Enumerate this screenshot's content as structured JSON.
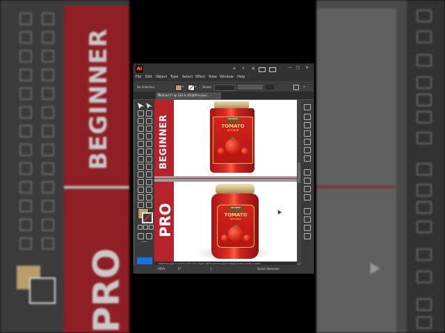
{
  "app": {
    "logo": "Ai",
    "menu": [
      "File",
      "Edit",
      "Object",
      "Type",
      "Select",
      "Effect",
      "View",
      "Window",
      "Help"
    ],
    "window_controls": [
      "—",
      "▢",
      "✕"
    ]
  },
  "control_bar": {
    "selection": "No Selection",
    "stroke_label": "Stroke:",
    "stroke_value": "0"
  },
  "document_tab": {
    "title": "Untitled-1* @ 100 % (RGB/Preview)",
    "close": "×"
  },
  "artboards": [
    {
      "label": "BEGINNER",
      "jar": {
        "brand": "NEW BRAND",
        "title": "TOMATO",
        "subtitle": "KETCHUP"
      }
    },
    {
      "label": "PRO",
      "jar": {
        "brand": "NEW BRAND",
        "title": "TOMATO",
        "subtitle": "KETCHUP"
      }
    }
  ],
  "status": {
    "hint": "Select the path or anchor point of an object  |  Shift+Click to select multiple anchor points or paths",
    "zoom": "100%",
    "rotation": "0°",
    "artboard_num": "1",
    "tool": "Direct Selection"
  },
  "background_copy": {
    "label_top": "BEGINNER",
    "label_bottom": "PRO"
  },
  "colors": {
    "accent_red": "#b8222b",
    "fill_swatch": "#b79e6b",
    "edit_toolbar_blue": "#1473e6"
  }
}
